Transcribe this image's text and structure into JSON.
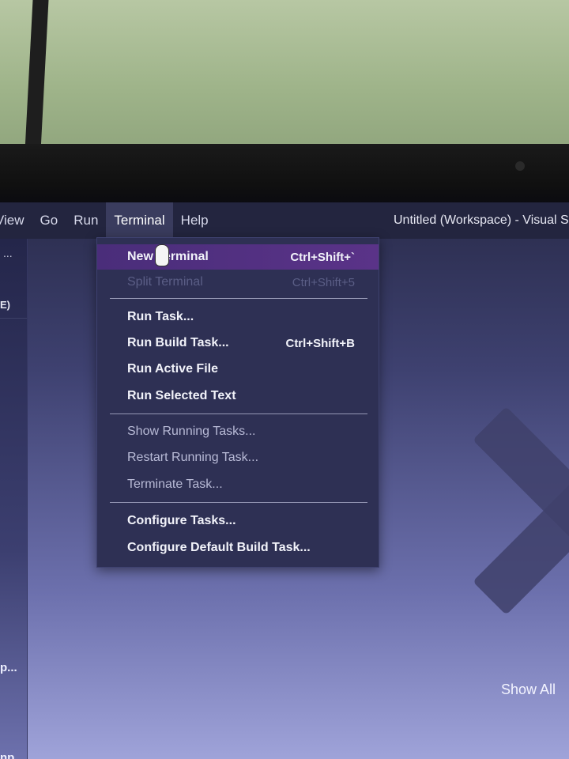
{
  "menubar": {
    "items": [
      {
        "label": "View"
      },
      {
        "label": "Go"
      },
      {
        "label": "Run"
      },
      {
        "label": "Terminal"
      },
      {
        "label": "Help"
      }
    ],
    "window_title": "Untitled (Workspace) - Visual S"
  },
  "sidebar": {
    "dots": "...",
    "section_label": "E)",
    "item1": "p...",
    "item2": "np"
  },
  "terminal_menu": {
    "items": [
      {
        "label": "New Terminal",
        "shortcut": "Ctrl+Shift+`"
      },
      {
        "label": "Split Terminal",
        "shortcut": "Ctrl+Shift+5"
      },
      {
        "label": "Run Task..."
      },
      {
        "label": "Run Build Task...",
        "shortcut": "Ctrl+Shift+B"
      },
      {
        "label": "Run Active File"
      },
      {
        "label": "Run Selected Text"
      },
      {
        "label": "Show Running Tasks..."
      },
      {
        "label": "Restart Running Task..."
      },
      {
        "label": "Terminate Task..."
      },
      {
        "label": "Configure Tasks..."
      },
      {
        "label": "Configure Default Build Task..."
      }
    ]
  },
  "main": {
    "show_all_label": "Show All"
  },
  "colors": {
    "menubar_bg": "#23253f",
    "menu_bg": "#2e3054",
    "highlight": "#5a3388"
  }
}
